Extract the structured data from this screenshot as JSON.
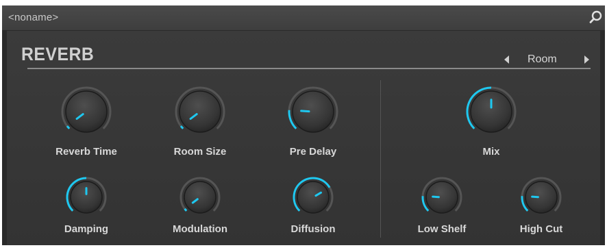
{
  "header": {
    "preset_name": "<noname>",
    "search_icon": "search-icon"
  },
  "effect": {
    "title": "REVERB",
    "mode": "Room",
    "prev_icon": "triangle-left-icon",
    "next_icon": "triangle-right-icon"
  },
  "colors": {
    "accent": "#1ec8f0",
    "panel": "#363636",
    "knob_body": "#3a3a3a",
    "track": "#555555"
  },
  "knobs": [
    {
      "id": "reverb-time",
      "label": "Reverb Time",
      "value": 0.03
    },
    {
      "id": "room-size",
      "label": "Room Size",
      "value": 0.03
    },
    {
      "id": "pre-delay",
      "label": "Pre Delay",
      "value": 0.18
    },
    {
      "id": "mix",
      "label": "Mix",
      "value": 0.5
    },
    {
      "id": "damping",
      "label": "Damping",
      "value": 0.5
    },
    {
      "id": "modulation",
      "label": "Modulation",
      "value": 0.03
    },
    {
      "id": "diffusion",
      "label": "Diffusion",
      "value": 0.72
    },
    {
      "id": "low-shelf",
      "label": "Low Shelf",
      "value": 0.18
    },
    {
      "id": "high-cut",
      "label": "High Cut",
      "value": 0.18
    }
  ]
}
